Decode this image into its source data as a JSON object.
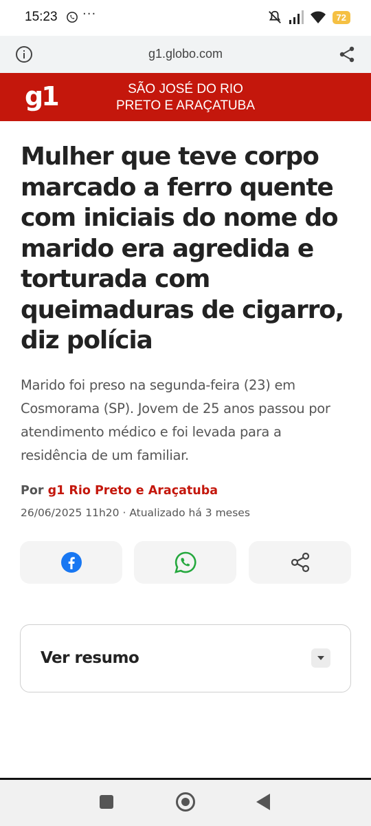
{
  "status_bar": {
    "time": "15:23",
    "more": "···",
    "battery": "72"
  },
  "browser": {
    "url": "g1.globo.com"
  },
  "site_header": {
    "logo": "g1",
    "region_line1": "SÃO JOSÉ DO RIO",
    "region_line2": "PRETO E ARAÇATUBA",
    "brand_color": "#c4170c"
  },
  "article": {
    "headline": "Mulher que teve corpo marcado a ferro quente com iniciais do nome do marido era agredida e torturada com queimaduras de cigarro, diz polícia",
    "subtitle": "Marido foi preso na segunda-feira (23) em Cosmorama (SP). Jovem de 25 anos passou por atendimento médico e foi levada para a residência de um familiar.",
    "byline_prefix": "Por",
    "byline_author": "g1 Rio Preto e Araçatuba",
    "dateline": "26/06/2025 11h20 · Atualizado há 3 meses"
  },
  "share": {
    "facebook_icon": "facebook-icon",
    "whatsapp_icon": "whatsapp-icon",
    "share_icon": "share-icon"
  },
  "summary": {
    "label": "Ver resumo"
  }
}
